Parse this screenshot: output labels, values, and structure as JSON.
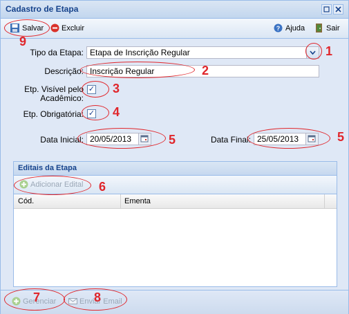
{
  "window": {
    "title": "Cadastro de Etapa",
    "minimize_icon": "minimize-icon",
    "close_icon": "close-icon"
  },
  "toolbar": {
    "save": "Salvar",
    "delete": "Excluir",
    "help": "Ajuda",
    "exit": "Sair"
  },
  "form": {
    "tipo_label": "Tipo da Etapa:",
    "tipo_value": "Etapa de Inscrição Regular",
    "descricao_label": "Descrição:",
    "descricao_value": "Inscrição Regular",
    "visivel_label_1": "Etp. Visível pelo",
    "visivel_label_2": "Acadêmico:",
    "visivel_checked": true,
    "obrigatoria_label": "Etp. Obrigatória:",
    "obrigatoria_checked": true,
    "data_inicial_label": "Data Inicial:",
    "data_inicial_value": "20/05/2013",
    "data_final_label": "Data Final:",
    "data_final_value": "25/05/2013"
  },
  "editais": {
    "title": "Editais da Etapa",
    "add_button": "Adicionar Edital",
    "columns": [
      "Cód.",
      "Ementa"
    ]
  },
  "footer": {
    "manage": "Gerenciar",
    "send_email": "Enviar Email"
  },
  "annotations": [
    "1",
    "2",
    "3",
    "4",
    "5",
    "5",
    "6",
    "7",
    "8",
    "9"
  ],
  "colors": {
    "annotation": "#e0262b",
    "title_text": "#15428b",
    "window_bg": "#dfe8f6"
  }
}
